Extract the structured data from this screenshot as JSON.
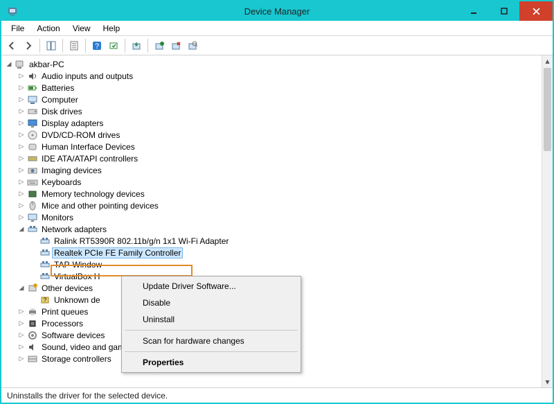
{
  "window": {
    "title": "Device Manager"
  },
  "menu": {
    "file": "File",
    "action": "Action",
    "view": "View",
    "help": "Help"
  },
  "tree": {
    "root": "akbar-PC",
    "items": [
      "Audio inputs and outputs",
      "Batteries",
      "Computer",
      "Disk drives",
      "Display adapters",
      "DVD/CD-ROM drives",
      "Human Interface Devices",
      "IDE ATA/ATAPI controllers",
      "Imaging devices",
      "Keyboards",
      "Memory technology devices",
      "Mice and other pointing devices",
      "Monitors"
    ],
    "network": {
      "label": "Network adapters",
      "children": [
        "Ralink RT5390R 802.11b/g/n 1x1 Wi-Fi Adapter",
        "Realtek PCIe FE Family Controller",
        "TAP-Window",
        "VirtualBox H"
      ]
    },
    "other": {
      "label": "Other devices",
      "children": [
        "Unknown de"
      ]
    },
    "rest": [
      "Print queues",
      "Processors",
      "Software devices",
      "Sound, video and game controllers",
      "Storage controllers"
    ]
  },
  "context": {
    "update": "Update Driver Software...",
    "disable": "Disable",
    "uninstall": "Uninstall",
    "scan": "Scan for hardware changes",
    "properties": "Properties"
  },
  "status": "Uninstalls the driver for the selected device."
}
